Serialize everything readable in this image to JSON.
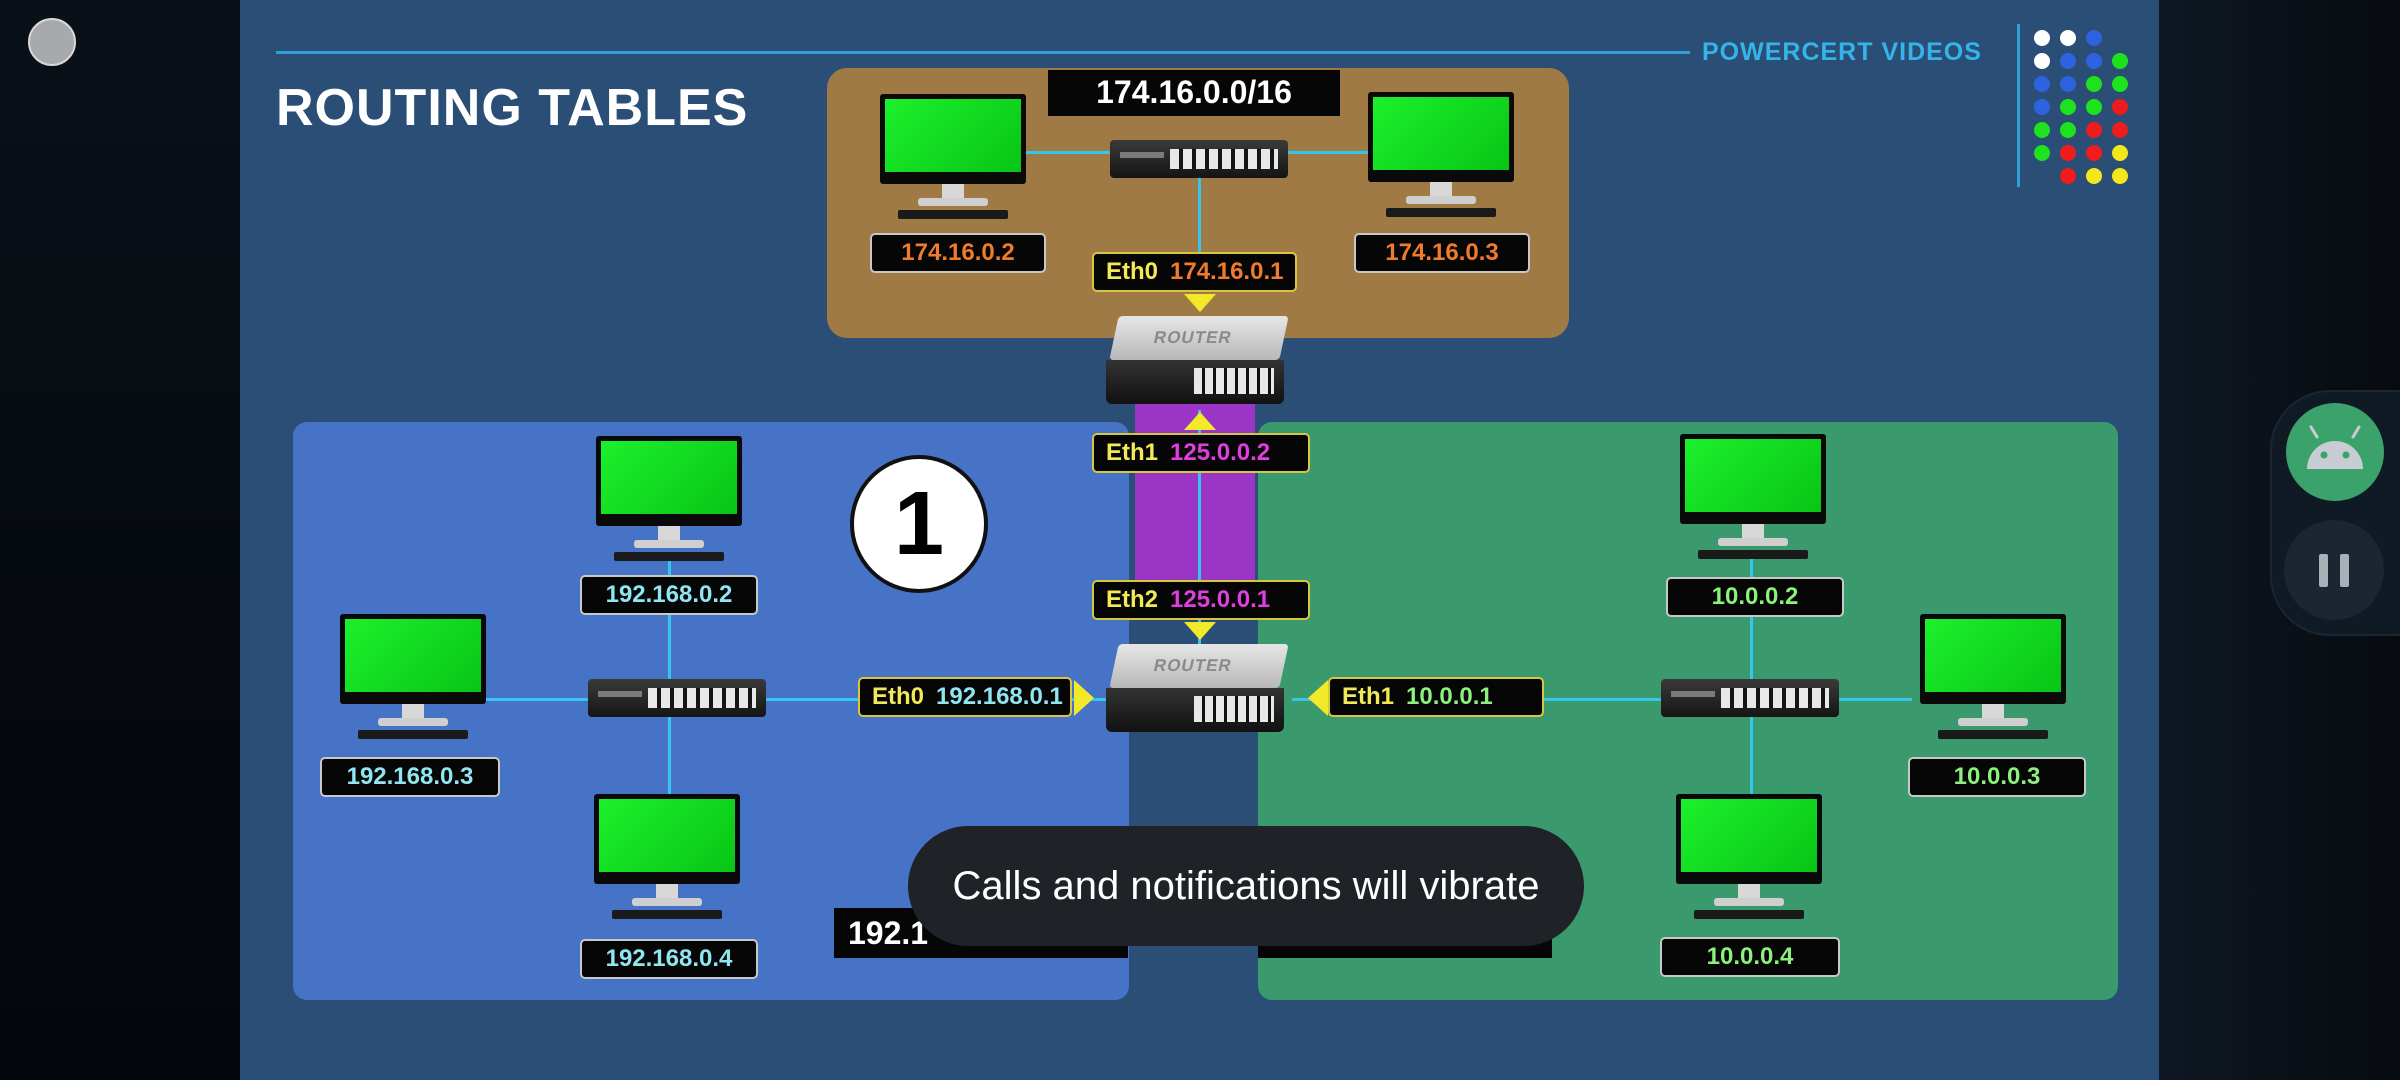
{
  "slide": {
    "title": "ROUTING TABLES",
    "brand": "POWERCERT VIDEOS",
    "step_number": "1"
  },
  "networks": {
    "top": {
      "label": "174.16.0.0/16",
      "hosts": [
        "174.16.0.2",
        "174.16.0.3"
      ],
      "router_interface": {
        "name": "Eth0",
        "ip": "174.16.0.1"
      }
    },
    "left": {
      "label_partial": "192.1",
      "hosts": [
        "192.168.0.2",
        "192.168.0.3",
        "192.168.0.4"
      ],
      "router_interface": {
        "name": "Eth0",
        "ip": "192.168.0.1"
      }
    },
    "right": {
      "hosts": [
        "10.0.0.2",
        "10.0.0.3",
        "10.0.0.4"
      ],
      "router_interface": {
        "name": "Eth1",
        "ip": "10.0.0.1"
      }
    },
    "link": {
      "upper_interface": {
        "name": "Eth1",
        "ip": "125.0.0.2"
      },
      "lower_interface": {
        "name": "Eth2",
        "ip": "125.0.0.1"
      }
    }
  },
  "devices": {
    "router_label": "ROUTER"
  },
  "colors": {
    "background": "#2b4e77",
    "top_network": "#a07a45",
    "left_network": "#4673c6",
    "right_network": "#3a9a6d",
    "link": "#9b35c6",
    "wire": "#35c6ee",
    "interface_name": "#f2ea54",
    "top_ip": "#ef7b2c",
    "left_ip": "#8fe6f1",
    "right_ip": "#8cf07d",
    "link_ip": "#e03ee0"
  },
  "toast": {
    "message": "Calls and notifications will vibrate"
  },
  "overlay": {
    "record_icon": "circle-record-icon",
    "bubble_icon": "android-icon",
    "pause_icon": "pause-icon"
  }
}
